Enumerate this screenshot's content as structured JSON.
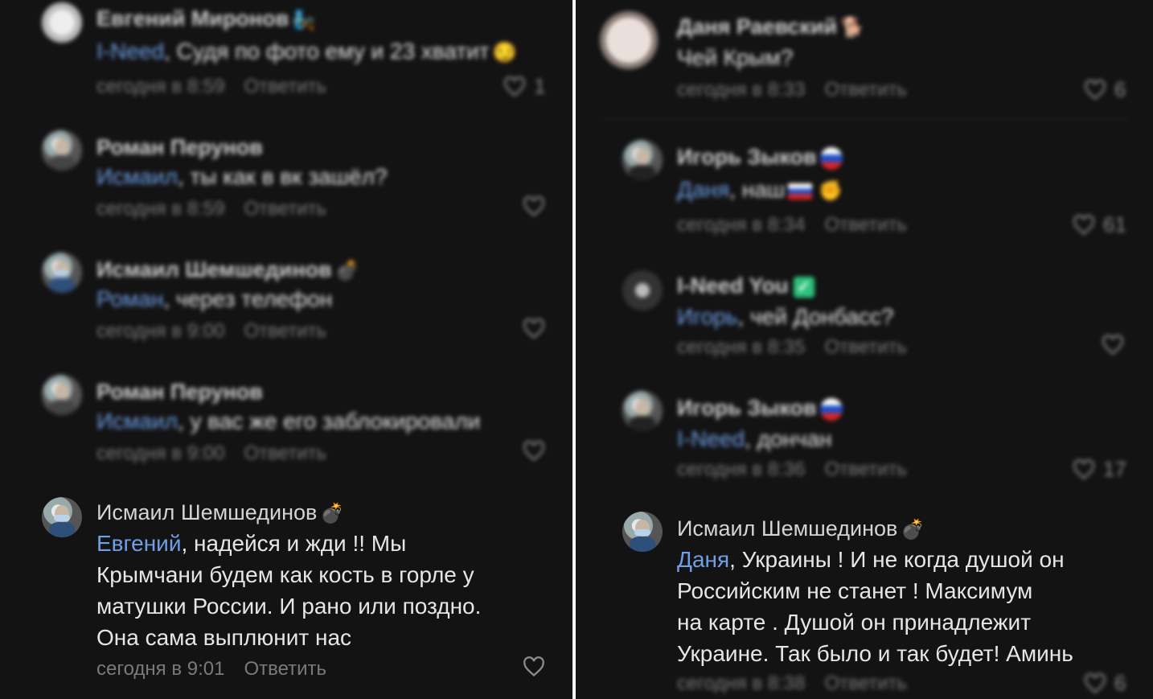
{
  "left_comments": [
    {
      "author": "Евгений Миронов",
      "badge": "🧞",
      "mention": "I-Need",
      "text": ", Судя по фото ему и 23 хватит",
      "emoji": "😏",
      "time": "сегодня в 8:59",
      "reply": "Ответить",
      "likes": "1"
    },
    {
      "author": "Роман Перунов",
      "mention": "Исмаил",
      "text": ", ты как в вк зашёл?",
      "time": "сегодня в 8:59",
      "reply": "Ответить",
      "likes": ""
    },
    {
      "author": "Исмаил Шемшединов",
      "badge": "💣",
      "mention": "Роман",
      "text": ", через телефон",
      "time": "сегодня в 9:00",
      "reply": "Ответить",
      "likes": ""
    },
    {
      "author": "Роман Перунов",
      "mention": "Исмаил",
      "text": ", у вас же его заблокировали",
      "time": "сегодня в 9:00",
      "reply": "Ответить",
      "likes": ""
    },
    {
      "author": "Исмаил Шемшединов",
      "badge": "💣",
      "mention": "Евгений",
      "lines": [
        ", надейся и жди !! Мы",
        "Крымчани будем как кость в горле у",
        "матушки России.  И рано или поздно.",
        "Она сама выплюнит нас"
      ],
      "time": "сегодня в 9:01",
      "reply": "Ответить",
      "likes": ""
    }
  ],
  "right_comments": [
    {
      "author": "Даня Раевский",
      "badge": "🐕",
      "text": "Чей Крым?",
      "time": "сегодня в 8:33",
      "reply": "Ответить",
      "likes": "6"
    },
    {
      "author": "Игорь Зыков",
      "mention": "Даня",
      "text": ", наш",
      "emoji": "✊",
      "time": "сегодня в 8:34",
      "reply": "Ответить",
      "likes": "61"
    },
    {
      "author": "I-Need You",
      "badge": "✅",
      "mention": "Игорь",
      "text": ", чей Донбасс?",
      "time": "сегодня в 8:35",
      "reply": "Ответить",
      "likes": ""
    },
    {
      "author": "Игорь Зыков",
      "mention": "I-Need",
      "text": ", дончан",
      "time": "сегодня в 8:36",
      "reply": "Ответить",
      "likes": "17"
    },
    {
      "author": "Исмаил Шемшединов",
      "badge": "💣",
      "mention": "Даня",
      "lines": [
        ", Украины ! И не когда душой он",
        "Российским не  станет ! Максимум",
        "на карте . Душой он принадлежит",
        "Украине.  Так было и так будет! Аминь"
      ],
      "time": "сегодня в 8:38",
      "reply": "Ответить",
      "likes": "6"
    }
  ],
  "colors": {
    "background": "#131314",
    "mention": "#6f9fe6",
    "text": "#e6e6e6",
    "meta": "#7a7a7a",
    "divider": "#f2f2f2"
  }
}
